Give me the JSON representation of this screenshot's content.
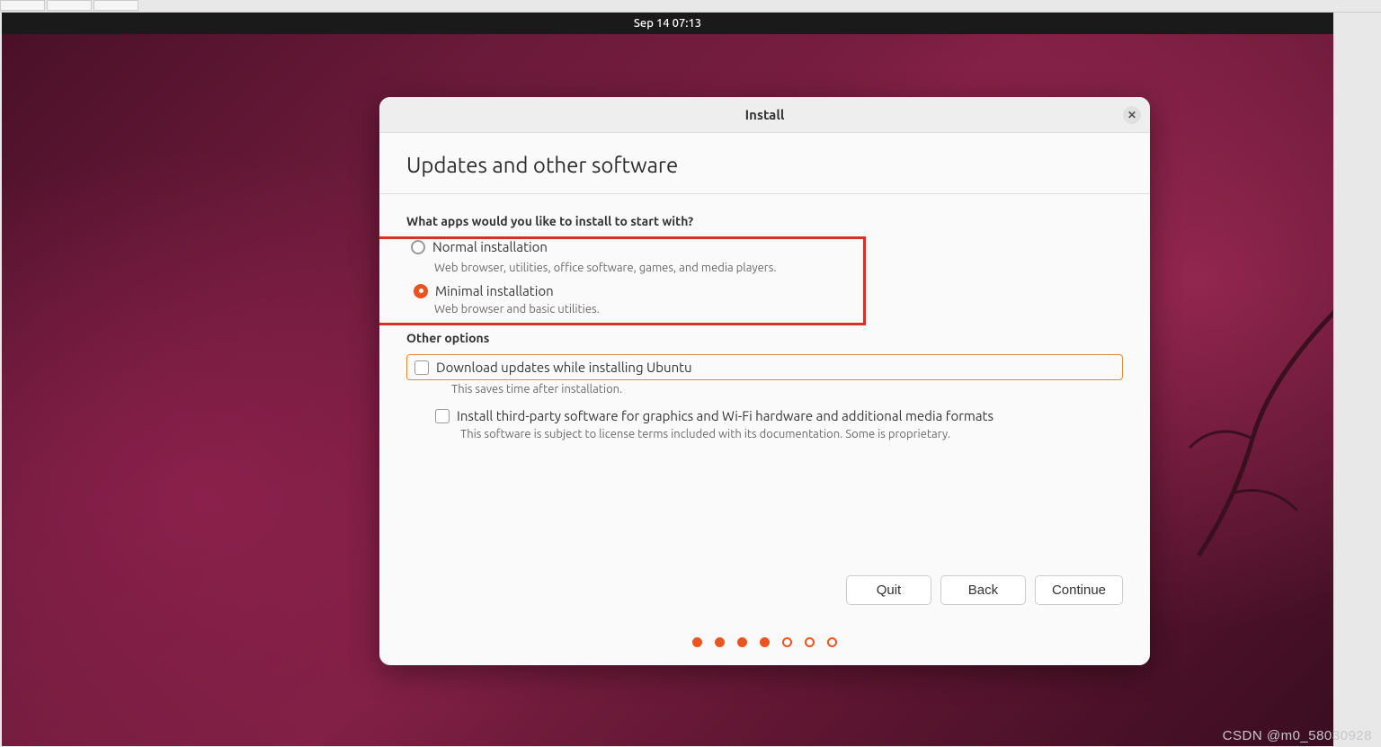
{
  "topbar": {
    "datetime": "Sep 14  07:13"
  },
  "dialog": {
    "title": "Install",
    "heading": "Updates and other software",
    "question": "What apps would you like to install to start with?",
    "options": {
      "normal": {
        "label": "Normal installation",
        "desc": "Web browser, utilities, office software, games, and media players."
      },
      "minimal": {
        "label": "Minimal installation",
        "desc": "Web browser and basic utilities."
      }
    },
    "other_heading": "Other options",
    "checks": {
      "updates": {
        "label": "Download updates while installing Ubuntu",
        "desc": "This saves time after installation."
      },
      "thirdparty": {
        "label": "Install third-party software for graphics and Wi-Fi hardware and additional media formats",
        "desc": "This software is subject to license terms included with its documentation. Some is proprietary."
      }
    },
    "buttons": {
      "quit": "Quit",
      "back": "Back",
      "continue": "Continue"
    }
  },
  "pager": {
    "total": 7,
    "filled": 4,
    "current": 3
  },
  "watermark": "CSDN @m0_58030928"
}
